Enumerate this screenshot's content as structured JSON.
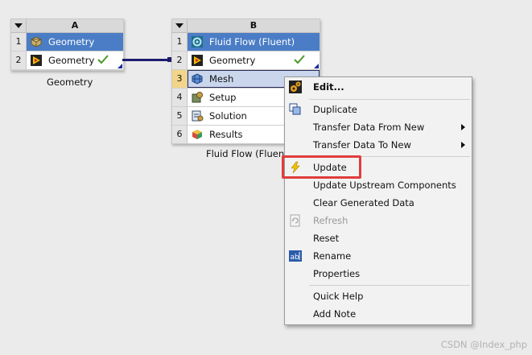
{
  "systemA": {
    "column": "A",
    "label": "Geometry",
    "rows": [
      {
        "num": "1",
        "text": "Geometry"
      },
      {
        "num": "2",
        "text": "Geometry"
      }
    ]
  },
  "systemB": {
    "column": "B",
    "label": "Fluid Flow (Fluent)",
    "rows": [
      {
        "num": "1",
        "text": "Fluid Flow (Fluent)"
      },
      {
        "num": "2",
        "text": "Geometry"
      },
      {
        "num": "3",
        "text": "Mesh"
      },
      {
        "num": "4",
        "text": "Setup"
      },
      {
        "num": "5",
        "text": "Solution"
      },
      {
        "num": "6",
        "text": "Results"
      }
    ]
  },
  "contextMenu": {
    "items": [
      {
        "label": "Edit..."
      },
      {
        "label": "Duplicate"
      },
      {
        "label": "Transfer Data From New"
      },
      {
        "label": "Transfer Data To New"
      },
      {
        "label": "Update"
      },
      {
        "label": "Update Upstream Components"
      },
      {
        "label": "Clear Generated Data"
      },
      {
        "label": "Refresh"
      },
      {
        "label": "Reset"
      },
      {
        "label": "Rename"
      },
      {
        "label": "Properties"
      },
      {
        "label": "Quick Help"
      },
      {
        "label": "Add Note"
      }
    ]
  },
  "watermark": "CSDN @Index_php",
  "colors": {
    "titleRow": "#4a7dc6",
    "highlight": "#e03c3c",
    "selection": "#c9d6ec"
  }
}
